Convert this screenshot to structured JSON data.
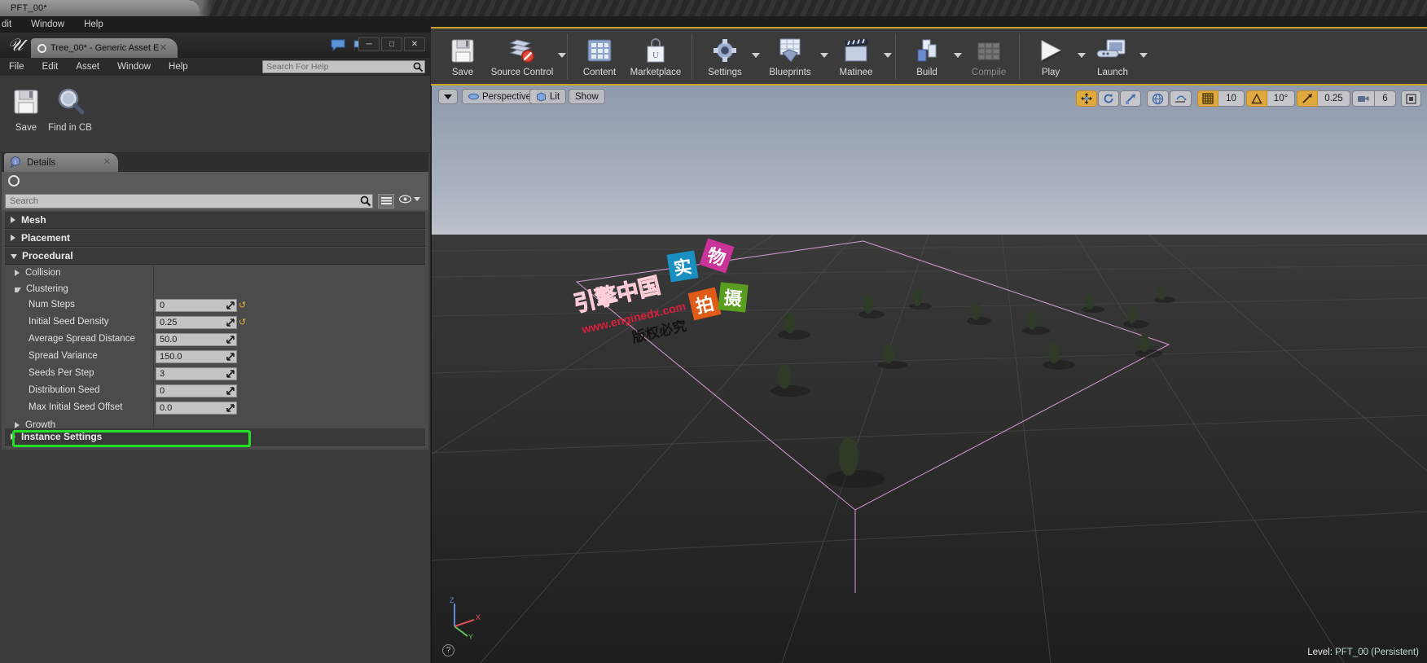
{
  "outer_window": {
    "tab_title": "PFT_00*",
    "menu": [
      "dit",
      "Window",
      "Help"
    ]
  },
  "asset_editor": {
    "tab_title": "Tree_00* - Generic Asset E",
    "menu": [
      "File",
      "Edit",
      "Asset",
      "Window",
      "Help"
    ],
    "help_search_placeholder": "Search For Help",
    "toolbar": [
      {
        "label": "Save",
        "icon": "save-icon"
      },
      {
        "label": "Find in CB",
        "icon": "find-in-content-browser-icon"
      }
    ],
    "window_buttons": [
      "minimize",
      "maximize",
      "close"
    ]
  },
  "details_panel": {
    "tab_label": "Details",
    "search_placeholder": "Search",
    "categories": [
      {
        "label": "Mesh",
        "expanded": false
      },
      {
        "label": "Placement",
        "expanded": false
      },
      {
        "label": "Procedural",
        "expanded": true
      },
      {
        "label": "Instance Settings",
        "expanded": false
      }
    ],
    "procedural": {
      "subsections": [
        {
          "label": "Collision",
          "expanded": false
        },
        {
          "label": "Clustering",
          "expanded": true
        },
        {
          "label": "Growth",
          "expanded": false
        }
      ],
      "clustering_properties": [
        {
          "label": "Num Steps",
          "value": "0",
          "has_revert": true,
          "highlighted": false
        },
        {
          "label": "Initial Seed Density",
          "value": "0.25",
          "has_revert": true,
          "highlighted": true
        },
        {
          "label": "Average Spread Distance",
          "value": "50.0",
          "has_revert": false,
          "highlighted": false
        },
        {
          "label": "Spread Variance",
          "value": "150.0",
          "has_revert": false,
          "highlighted": false
        },
        {
          "label": "Seeds Per Step",
          "value": "3",
          "has_revert": false,
          "highlighted": false
        },
        {
          "label": "Distribution Seed",
          "value": "0",
          "has_revert": false,
          "highlighted": false
        },
        {
          "label": "Max Initial Seed Offset",
          "value": "0.0",
          "has_revert": false,
          "highlighted": false
        }
      ]
    },
    "highlight_color": "#22e022"
  },
  "main_toolbar": {
    "groups": [
      {
        "items": [
          {
            "label": "Save",
            "icon": "save-icon",
            "caret": false,
            "disabled": false
          },
          {
            "label": "Source Control",
            "icon": "source-control-icon",
            "caret": true,
            "disabled": false
          }
        ]
      },
      {
        "items": [
          {
            "label": "Content",
            "icon": "content-browser-icon",
            "caret": false,
            "disabled": false
          },
          {
            "label": "Marketplace",
            "icon": "marketplace-icon",
            "caret": false,
            "disabled": false
          }
        ]
      },
      {
        "items": [
          {
            "label": "Settings",
            "icon": "settings-gear-icon",
            "caret": true,
            "disabled": false
          },
          {
            "label": "Blueprints",
            "icon": "blueprints-icon",
            "caret": true,
            "disabled": false
          },
          {
            "label": "Matinee",
            "icon": "matinee-clapboard-icon",
            "caret": true,
            "disabled": false
          }
        ]
      },
      {
        "items": [
          {
            "label": "Build",
            "icon": "build-icon",
            "caret": true,
            "disabled": false
          },
          {
            "label": "Compile",
            "icon": "compile-icon",
            "caret": false,
            "disabled": true
          }
        ]
      },
      {
        "items": [
          {
            "label": "Play",
            "icon": "play-icon",
            "caret": true,
            "disabled": false
          },
          {
            "label": "Launch",
            "icon": "launch-icon",
            "caret": true,
            "disabled": false
          }
        ]
      }
    ]
  },
  "viewport": {
    "left_controls": {
      "menu_caret": "viewport-options-caret",
      "camera_mode": "Perspective",
      "view_mode": "Lit",
      "show_menu": "Show"
    },
    "right_controls": {
      "transform_modes": [
        "select-translate",
        "rotate",
        "scale"
      ],
      "coordinate_system": "world-coordinate-icon",
      "surface_snap": "surface-snap-icon",
      "grid_snap_enabled": true,
      "grid_snap_value": "10",
      "angle_snap_enabled": true,
      "angle_snap_value": "10°",
      "scale_snap_enabled": true,
      "scale_snap_value": "0.25",
      "camera_speed_value": "6",
      "maximize_icon": "maximize-viewport-icon"
    },
    "status": {
      "level_label": "Level:",
      "level_name": "PFT_00 (Persistent)"
    },
    "axis_gizmo": {
      "x": "X",
      "y": "Y",
      "z": "Z"
    },
    "watermark": {
      "tiles": [
        {
          "char": "实",
          "color": "#1a8fc1"
        },
        {
          "char": "物",
          "color": "#cc3399"
        },
        {
          "char": "拍",
          "color": "#e05a18"
        },
        {
          "char": "摄",
          "color": "#5a9e1f"
        }
      ],
      "text_main": "引擎中国",
      "text_url": "www.enginedx.com",
      "text_sub": "版权必究"
    }
  }
}
